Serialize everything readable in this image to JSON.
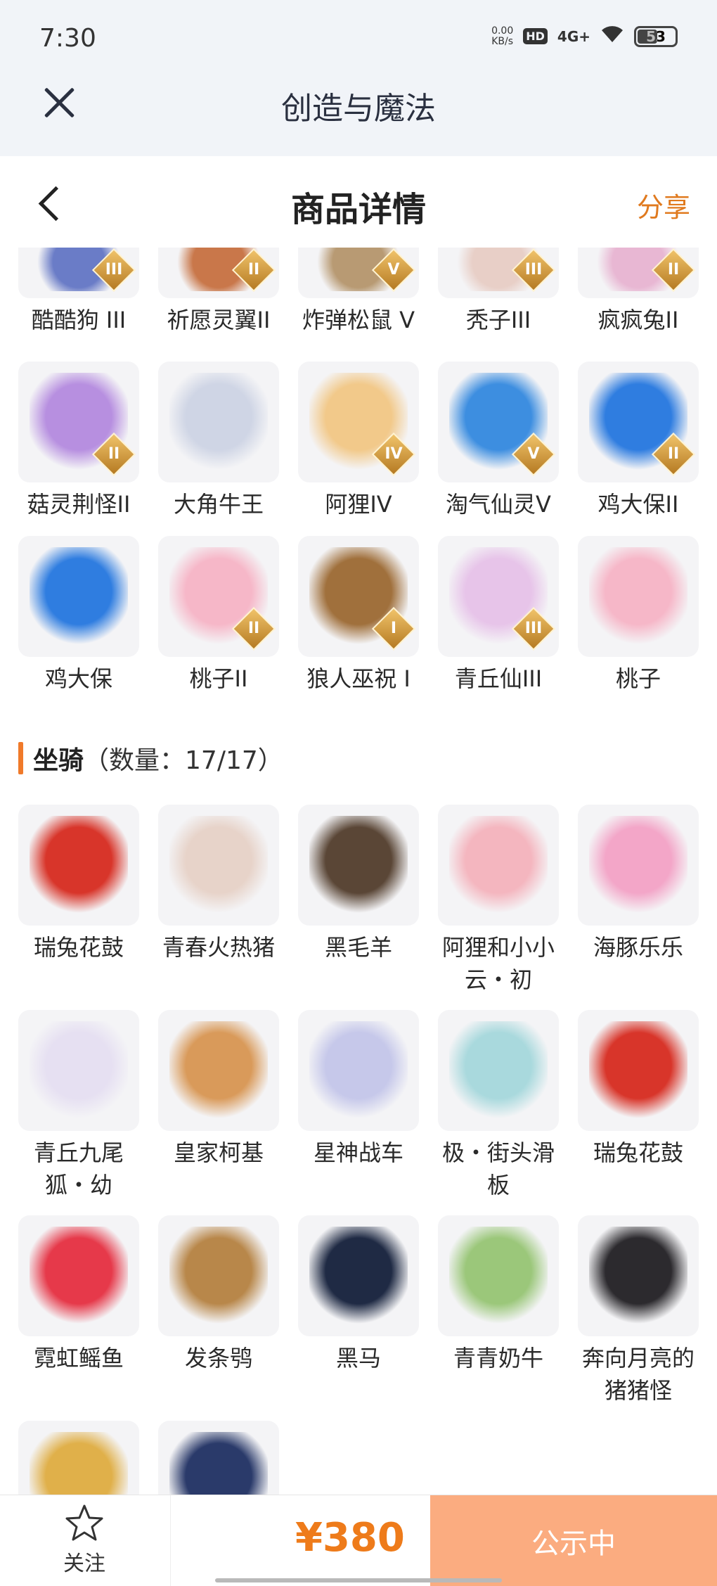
{
  "status_bar": {
    "time": "7:30",
    "net_speed_value": "0.00",
    "net_speed_unit": "KB/s",
    "hd": "HD",
    "network": "4G+",
    "battery": "53"
  },
  "app_bar": {
    "title": "创造与魔法"
  },
  "header": {
    "title": "商品详情",
    "share": "分享"
  },
  "pets_partial_row": [
    {
      "name": "酷酷狗 III",
      "grade": "III",
      "color": "#6a7cc7"
    },
    {
      "name": "祈愿灵翼II",
      "grade": "II",
      "color": "#c9774a"
    },
    {
      "name": "炸弹松鼠 V",
      "grade": "V",
      "color": "#b89a73"
    },
    {
      "name": "秃子III",
      "grade": "III",
      "color": "#e8cfc7"
    },
    {
      "name": "疯疯兔II",
      "grade": "II",
      "color": "#e8b7d3"
    }
  ],
  "pets_rows": [
    {
      "name": "菇灵荆怪II",
      "grade": "II",
      "color": "#b78fe0"
    },
    {
      "name": "大角牛王",
      "grade": "",
      "color": "#cfd5e5"
    },
    {
      "name": "阿狸IV",
      "grade": "IV",
      "color": "#f2c98a"
    },
    {
      "name": "淘气仙灵V",
      "grade": "V",
      "color": "#3d8ee0"
    },
    {
      "name": "鸡大保II",
      "grade": "II",
      "color": "#2f7de0"
    },
    {
      "name": "鸡大保",
      "grade": "",
      "color": "#2f7de0"
    },
    {
      "name": "桃子II",
      "grade": "II",
      "color": "#f6b7c8"
    },
    {
      "name": "狼人巫祝 I",
      "grade": "I",
      "color": "#a0703c"
    },
    {
      "name": "青丘仙III",
      "grade": "III",
      "color": "#e7c4e9"
    },
    {
      "name": "桃子",
      "grade": "",
      "color": "#f6b7c8"
    }
  ],
  "mounts_section": {
    "label": "坐骑",
    "count": "（数量：17/17）"
  },
  "mounts": [
    {
      "name": "瑞兔花鼓",
      "color": "#d8352a"
    },
    {
      "name": "青春火热猪",
      "color": "#e7d3c9"
    },
    {
      "name": "黑毛羊",
      "color": "#5a4636"
    },
    {
      "name": "阿狸和小小云・初",
      "color": "#f4b6bf"
    },
    {
      "name": "海豚乐乐",
      "color": "#f3a6c8"
    },
    {
      "name": "青丘九尾狐・幼",
      "color": "#e6e0f2"
    },
    {
      "name": "皇家柯基",
      "color": "#d99a5a"
    },
    {
      "name": "星神战车",
      "color": "#c6c8ea"
    },
    {
      "name": "极・街头滑板",
      "color": "#a9d9dd"
    },
    {
      "name": "瑞兔花鼓",
      "color": "#d8352a"
    },
    {
      "name": "霓虹鳐鱼",
      "color": "#e6394a"
    },
    {
      "name": "发条鸮",
      "color": "#b8874a"
    },
    {
      "name": "黑马",
      "color": "#1f2a44"
    },
    {
      "name": "青青奶牛",
      "color": "#9bc77a"
    },
    {
      "name": "奔向月亮的猪猪怪",
      "color": "#2c2a2e"
    },
    {
      "name": "",
      "color": "#e0b04a"
    },
    {
      "name": "",
      "color": "#2a3a6a"
    }
  ],
  "bottom_bar": {
    "follow": "关注",
    "price": "¥380",
    "status": "公示中"
  }
}
